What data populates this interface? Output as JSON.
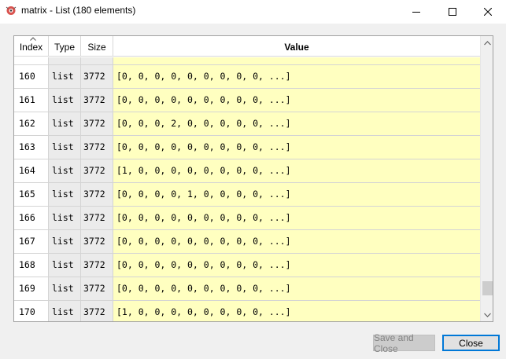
{
  "window": {
    "title": "matrix - List (180 elements)",
    "app_icon": "bug-icon",
    "controls": [
      "minimize-icon",
      "maximize-icon",
      "close-icon"
    ]
  },
  "table": {
    "headers": {
      "index": "Index",
      "type": "Type",
      "size": "Size",
      "value": "Value"
    },
    "sort_indicator": "sort-ascending-icon",
    "rows": [
      {
        "index": "160",
        "type": "list",
        "size": "3772",
        "value": "[0, 0, 0, 0, 0, 0, 0, 0, 0, ...]"
      },
      {
        "index": "161",
        "type": "list",
        "size": "3772",
        "value": "[0, 0, 0, 0, 0, 0, 0, 0, 0, ...]"
      },
      {
        "index": "162",
        "type": "list",
        "size": "3772",
        "value": "[0, 0, 0, 2, 0, 0, 0, 0, 0, ...]"
      },
      {
        "index": "163",
        "type": "list",
        "size": "3772",
        "value": "[0, 0, 0, 0, 0, 0, 0, 0, 0, ...]"
      },
      {
        "index": "164",
        "type": "list",
        "size": "3772",
        "value": "[1, 0, 0, 0, 0, 0, 0, 0, 0, ...]"
      },
      {
        "index": "165",
        "type": "list",
        "size": "3772",
        "value": "[0, 0, 0, 0, 1, 0, 0, 0, 0, ...]"
      },
      {
        "index": "166",
        "type": "list",
        "size": "3772",
        "value": "[0, 0, 0, 0, 0, 0, 0, 0, 0, ...]"
      },
      {
        "index": "167",
        "type": "list",
        "size": "3772",
        "value": "[0, 0, 0, 0, 0, 0, 0, 0, 0, ...]"
      },
      {
        "index": "168",
        "type": "list",
        "size": "3772",
        "value": "[0, 0, 0, 0, 0, 0, 0, 0, 0, ...]"
      },
      {
        "index": "169",
        "type": "list",
        "size": "3772",
        "value": "[0, 0, 0, 0, 0, 0, 0, 0, 0, ...]"
      },
      {
        "index": "170",
        "type": "list",
        "size": "3772",
        "value": "[1, 0, 0, 0, 0, 0, 0, 0, 0, ...]"
      }
    ]
  },
  "colors": {
    "value_cell_bg": "#ffffc0",
    "type_size_cell_bg": "#ebebeb",
    "close_button_border": "#0078d7"
  },
  "buttons": {
    "save_and_close": "Save and Close",
    "close": "Close"
  }
}
